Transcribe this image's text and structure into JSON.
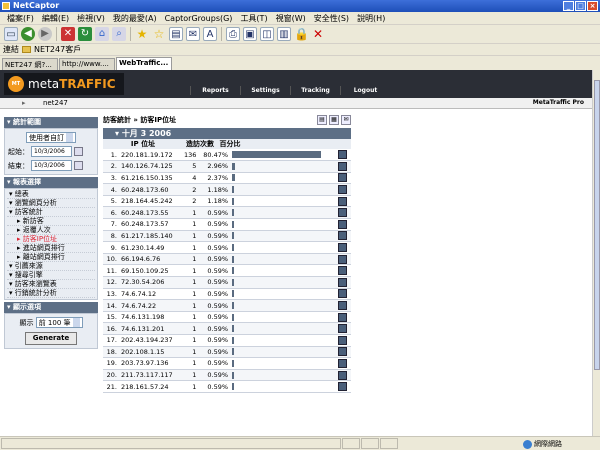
{
  "window": {
    "title": "NetCaptor"
  },
  "menubar": {
    "items": [
      "檔案(F)",
      "編輯(E)",
      "檢視(V)",
      "我的最愛(A)",
      "CaptorGroups(G)",
      "工具(T)",
      "視窗(W)",
      "安全性(S)",
      "說明(H)"
    ]
  },
  "linksbar": {
    "label": "連結",
    "favorite": "NET247客戶"
  },
  "tabs": [
    {
      "label": "NET247 網?..."
    },
    {
      "label": "http://www...."
    },
    {
      "label": "WebTraffic..."
    }
  ],
  "metatraffic": {
    "logo_brand": "meta",
    "logo_accent": "TRAFFIC",
    "nav": [
      "Reports",
      "Settings",
      "Tracking",
      "Logout"
    ],
    "site": "net247",
    "edition": "MetaTraffic Pro"
  },
  "sidebar": {
    "stats_header": "統計範圍",
    "range_select": "使用者自訂",
    "start_label": "起始：",
    "start_date": "10/3/2006",
    "end_label": "結束：",
    "end_date": "10/3/2006",
    "report_header": "報表選擇",
    "items": [
      {
        "label": "總表",
        "sub": false,
        "active": false
      },
      {
        "label": "瀏覽網頁分析",
        "sub": false,
        "active": false
      },
      {
        "label": "訪客統計",
        "sub": false,
        "active": false
      },
      {
        "label": "新訪客",
        "sub": true,
        "active": false
      },
      {
        "label": "返覆人次",
        "sub": true,
        "active": false
      },
      {
        "label": "訪客IP位址",
        "sub": true,
        "active": true
      },
      {
        "label": "進站網頁排行",
        "sub": true,
        "active": false
      },
      {
        "label": "離站網頁排行",
        "sub": true,
        "active": false
      },
      {
        "label": "引薦來源",
        "sub": false,
        "active": false
      },
      {
        "label": "搜尋引擎",
        "sub": false,
        "active": false
      },
      {
        "label": "訪客來瀏覽表",
        "sub": false,
        "active": false
      },
      {
        "label": "行銷統計分析",
        "sub": false,
        "active": false
      }
    ],
    "display_header": "顯示選項",
    "display_label": "顯示",
    "display_value": "前 100 筆",
    "generate": "Generate"
  },
  "main": {
    "breadcrumb": "訪客統計 » 訪客IP位址",
    "date_header": "十月 3 2006",
    "col_ip": "IP 位址",
    "col_visits": "造訪次數",
    "col_pct": "百分比",
    "rows": [
      {
        "rank": "1.",
        "ip": "220.181.19.172",
        "visits": "136",
        "pct": "80.47%",
        "share": 0.8047
      },
      {
        "rank": "2.",
        "ip": "140.126.74.125",
        "visits": "5",
        "pct": "2.96%",
        "share": 0.0296
      },
      {
        "rank": "3.",
        "ip": "61.216.150.135",
        "visits": "4",
        "pct": "2.37%",
        "share": 0.0237
      },
      {
        "rank": "4.",
        "ip": "60.248.173.60",
        "visits": "2",
        "pct": "1.18%",
        "share": 0.0118
      },
      {
        "rank": "5.",
        "ip": "218.164.45.242",
        "visits": "2",
        "pct": "1.18%",
        "share": 0.0118
      },
      {
        "rank": "6.",
        "ip": "60.248.173.55",
        "visits": "1",
        "pct": "0.59%",
        "share": 0.0059
      },
      {
        "rank": "7.",
        "ip": "60.248.173.57",
        "visits": "1",
        "pct": "0.59%",
        "share": 0.0059
      },
      {
        "rank": "8.",
        "ip": "61.217.185.140",
        "visits": "1",
        "pct": "0.59%",
        "share": 0.0059
      },
      {
        "rank": "9.",
        "ip": "61.230.14.49",
        "visits": "1",
        "pct": "0.59%",
        "share": 0.0059
      },
      {
        "rank": "10.",
        "ip": "66.194.6.76",
        "visits": "1",
        "pct": "0.59%",
        "share": 0.0059
      },
      {
        "rank": "11.",
        "ip": "69.150.109.25",
        "visits": "1",
        "pct": "0.59%",
        "share": 0.0059
      },
      {
        "rank": "12.",
        "ip": "72.30.54.206",
        "visits": "1",
        "pct": "0.59%",
        "share": 0.0059
      },
      {
        "rank": "13.",
        "ip": "74.6.74.12",
        "visits": "1",
        "pct": "0.59%",
        "share": 0.0059
      },
      {
        "rank": "14.",
        "ip": "74.6.74.22",
        "visits": "1",
        "pct": "0.59%",
        "share": 0.0059
      },
      {
        "rank": "15.",
        "ip": "74.6.131.198",
        "visits": "1",
        "pct": "0.59%",
        "share": 0.0059
      },
      {
        "rank": "16.",
        "ip": "74.6.131.201",
        "visits": "1",
        "pct": "0.59%",
        "share": 0.0059
      },
      {
        "rank": "17.",
        "ip": "202.43.194.237",
        "visits": "1",
        "pct": "0.59%",
        "share": 0.0059
      },
      {
        "rank": "18.",
        "ip": "202.108.1.15",
        "visits": "1",
        "pct": "0.59%",
        "share": 0.0059
      },
      {
        "rank": "19.",
        "ip": "203.73.97.136",
        "visits": "1",
        "pct": "0.59%",
        "share": 0.0059
      },
      {
        "rank": "20.",
        "ip": "211.73.117.117",
        "visits": "1",
        "pct": "0.59%",
        "share": 0.0059
      },
      {
        "rank": "21.",
        "ip": "218.161.57.24",
        "visits": "1",
        "pct": "0.59%",
        "share": 0.0059
      }
    ]
  },
  "status": {
    "zone": "網際網路"
  },
  "colors": {
    "titlebar": "#2a5fcf",
    "header": "#2b2e36",
    "accent": "#f39a1f",
    "section": "#5d6f86",
    "bar": "#5a6b80"
  }
}
